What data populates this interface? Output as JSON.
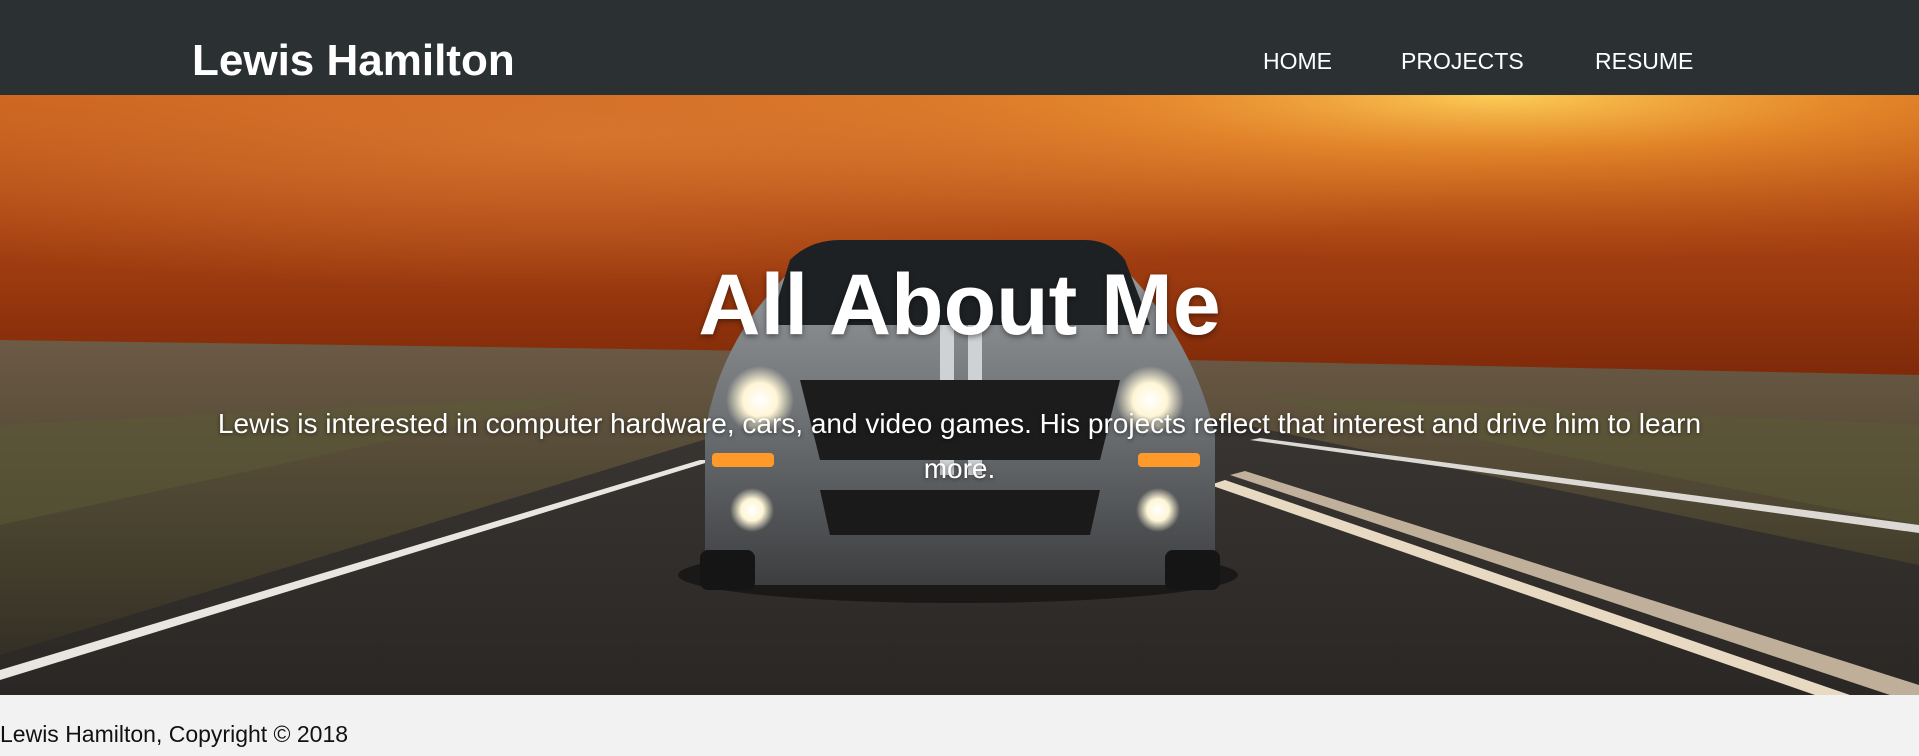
{
  "header": {
    "brand": "Lewis Hamilton",
    "nav": [
      {
        "label": "HOME"
      },
      {
        "label": "PROJECTS"
      },
      {
        "label": "RESUME"
      }
    ]
  },
  "hero": {
    "title": "All About Me",
    "text": "Lewis is interested in computer hardware, cars, and video games. His projects reflect that interest and drive him to learn more.",
    "image": "car-on-desert-road-at-sunset"
  },
  "footer": {
    "text": "Lewis Hamilton, Copyright © 2018"
  },
  "colors": {
    "navbar": "#2b3033",
    "footer": "#f2f2f2",
    "hero_text": "#ffffff"
  }
}
